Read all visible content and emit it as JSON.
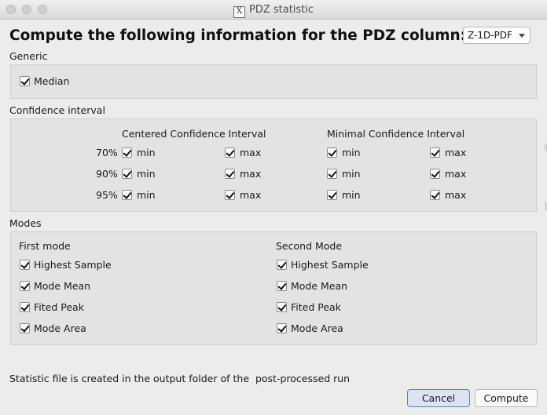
{
  "window": {
    "title": "PDZ statistic",
    "app_icon": "X"
  },
  "header": {
    "text": "Compute the following information for the PDZ column:",
    "column_select": "Z-1D-PDF"
  },
  "generic": {
    "label": "Generic",
    "median": "Median"
  },
  "confidence": {
    "label": "Confidence interval",
    "centered_title": "Centered Confidence Interval",
    "minimal_title": "Minimal Confidence Interval",
    "levels": [
      "70%",
      "90%",
      "95%"
    ],
    "min": "min",
    "max": "max"
  },
  "modes": {
    "label": "Modes",
    "first_title": "First mode",
    "second_title": "Second Mode",
    "items": [
      "Highest Sample",
      "Mode Mean",
      "Fited Peak",
      "Mode Area"
    ]
  },
  "footer": {
    "note": "Statistic file is created in the output folder of the  post-processed run"
  },
  "buttons": {
    "cancel": "Cancel",
    "compute": "Compute"
  }
}
